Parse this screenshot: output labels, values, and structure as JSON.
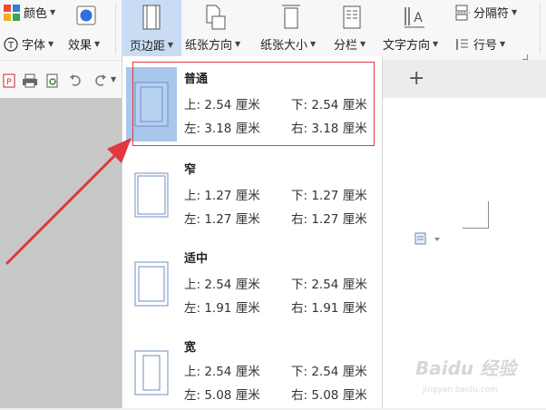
{
  "ribbon": {
    "color_label": "颜色",
    "font_label": "字体",
    "effect_label": "效果",
    "margins_label": "页边距",
    "orientation_label": "纸张方向",
    "size_label": "纸张大小",
    "columns_label": "分栏",
    "text_direction_label": "文字方向",
    "line_number_label": "行号",
    "separator_label": "分隔符"
  },
  "colors": {
    "active_tab_bg": "#c9dcf3",
    "selected_thumb_bg": "#a7c7ec",
    "annotation_red": "#e0383e"
  },
  "margins_menu": {
    "presets": [
      {
        "name": "普通",
        "top": "上: 2.54 厘米",
        "bottom": "下: 2.54 厘米",
        "left": "左: 3.18 厘米",
        "right": "右: 3.18 厘米",
        "selected": true
      },
      {
        "name": "窄",
        "top": "上: 1.27 厘米",
        "bottom": "下: 1.27 厘米",
        "left": "左: 1.27 厘米",
        "right": "右: 1.27 厘米",
        "selected": false
      },
      {
        "name": "适中",
        "top": "上: 2.54 厘米",
        "bottom": "下: 2.54 厘米",
        "left": "左: 1.91 厘米",
        "right": "右: 1.91 厘米",
        "selected": false
      },
      {
        "name": "宽",
        "top": "上: 2.54 厘米",
        "bottom": "下: 2.54 厘米",
        "left": "左: 5.08 厘米",
        "right": "右: 5.08 厘米",
        "selected": false
      }
    ]
  },
  "tabbar": {
    "new_tab_label": "+"
  },
  "watermark": {
    "brand": "Baidu 经验",
    "url": "jingyan.baidu.com"
  }
}
